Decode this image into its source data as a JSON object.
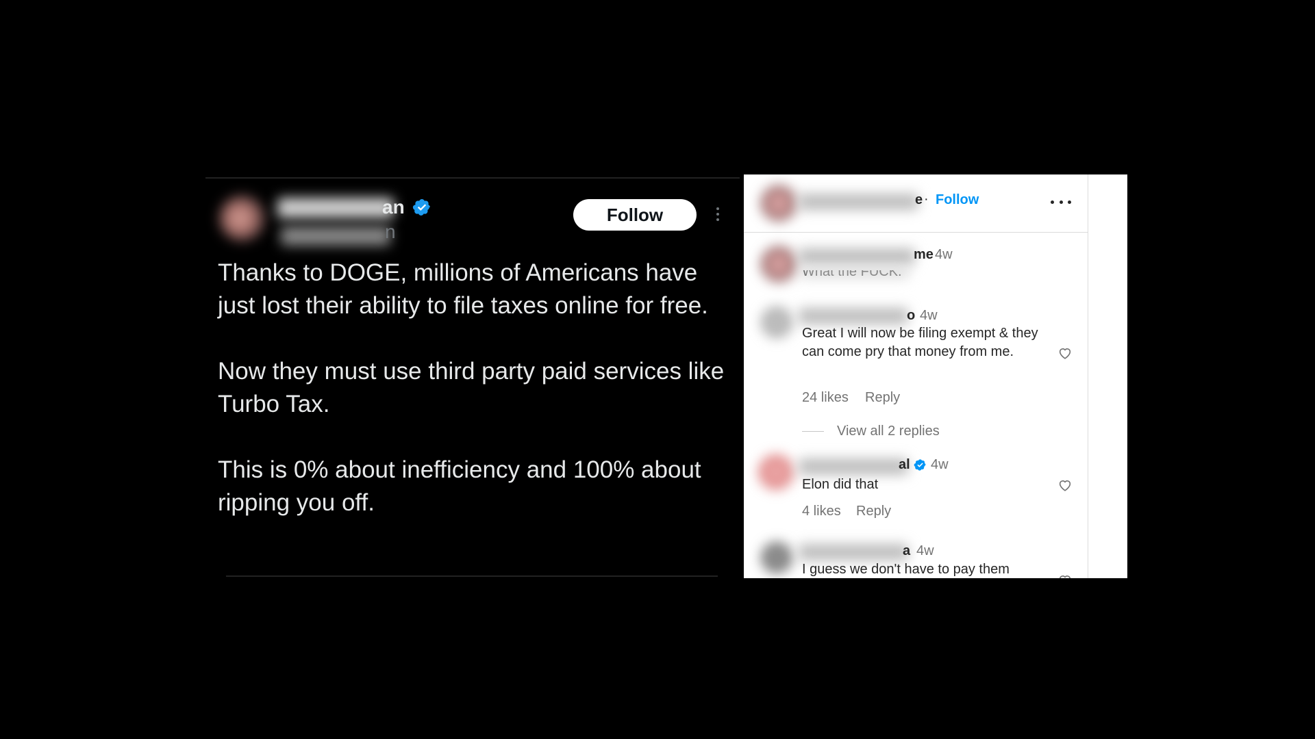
{
  "tweet": {
    "name_suffix": "an",
    "handle_suffix": "n",
    "follow_label": "Follow",
    "paragraphs": [
      "Thanks to DOGE, millions of Americans have just lost their ability to file taxes online for free.",
      "Now they must use third party paid services like Turbo Tax.",
      "This is 0% about inefficiency and 100% about ripping you off."
    ]
  },
  "instagram": {
    "header": {
      "username_suffix": "e",
      "dot": "·",
      "follow_label": "Follow"
    },
    "comments": [
      {
        "username_suffix": "me",
        "time": "4w",
        "text": "What the FUCK."
      },
      {
        "username_suffix": "o",
        "time": "4w",
        "text": "Great I will now be filing exempt & they can come pry that money from me.",
        "likes": "24 likes",
        "reply_label": "Reply",
        "view_replies": "View all 2 replies"
      },
      {
        "username_suffix": "al",
        "time": "4w",
        "text": "Elon did that",
        "likes": "4 likes",
        "reply_label": "Reply"
      },
      {
        "username_suffix": "a",
        "time": "4w",
        "text": "I guess we don't have to pay them"
      }
    ]
  },
  "colors": {
    "background": "#000000",
    "x_verified": "#1d9bf0",
    "ig_link": "#0095f6",
    "ig_text": "#262626",
    "ig_meta": "#737373"
  },
  "icons": [
    "x-verified-icon",
    "x-more-icon",
    "ig-more-icon",
    "ig-heart-icon",
    "ig-verified-icon"
  ]
}
